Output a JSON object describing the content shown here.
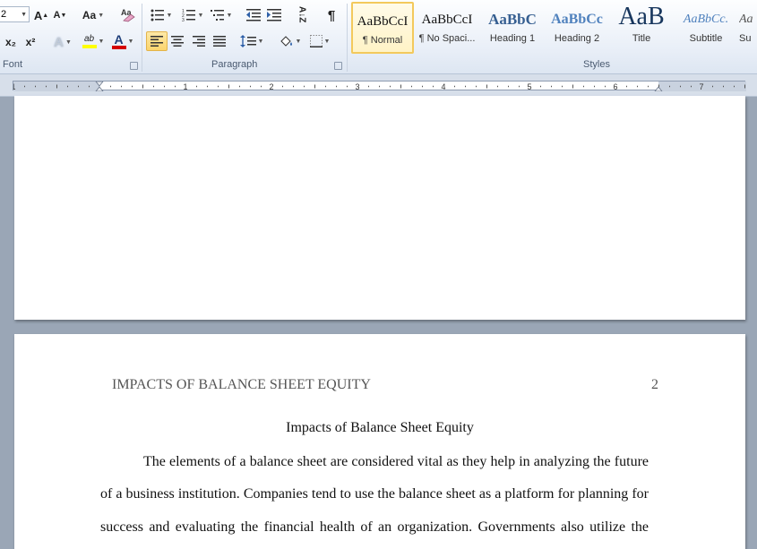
{
  "ribbon": {
    "font": {
      "size_value": "2",
      "label": "Font",
      "grow_label": "A",
      "shrink_label": "A",
      "change_case_label": "Aa",
      "subscript_label": "x₂",
      "superscript_label": "x²",
      "text_effects_label": "A",
      "highlight_label": "ab",
      "font_color_label": "A",
      "highlight_color": "#ffff00",
      "font_color": "#d40000"
    },
    "paragraph": {
      "label": "Paragraph",
      "sort_label": "A↓Z",
      "pilcrow_label": "¶"
    },
    "styles": {
      "label": "Styles",
      "items": [
        {
          "preview": "AaBbCcI",
          "name": "¶ Normal"
        },
        {
          "preview": "AaBbCcI",
          "name": "¶ No Spaci..."
        },
        {
          "preview": "AaBbC",
          "name": "Heading 1"
        },
        {
          "preview": "AaBbCc",
          "name": "Heading 2"
        },
        {
          "preview": "AaB",
          "name": "Title"
        },
        {
          "preview": "AaBbCc.",
          "name": "Subtitle"
        },
        {
          "preview": "Aa",
          "name": "Su"
        }
      ],
      "heading_color": "#365f91",
      "heading2_color": "#4f81bd",
      "title_color": "#17365d",
      "subtitle_color": "#4f81bd"
    }
  },
  "ruler": {
    "numbers": [
      "1",
      "1",
      "2",
      "3",
      "4",
      "5",
      "6",
      "7"
    ]
  },
  "document": {
    "header_title": "IMPACTS OF BALANCE SHEET EQUITY",
    "page_number": "2",
    "title": "Impacts of Balance Sheet Equity",
    "lines": [
      "The elements of a balance sheet are considered vital as they help in analyzing the future",
      "of a business institution. Companies tend to use the balance sheet as a platform for planning for",
      "success and evaluating the financial health of an organization. Governments also utilize the"
    ]
  }
}
